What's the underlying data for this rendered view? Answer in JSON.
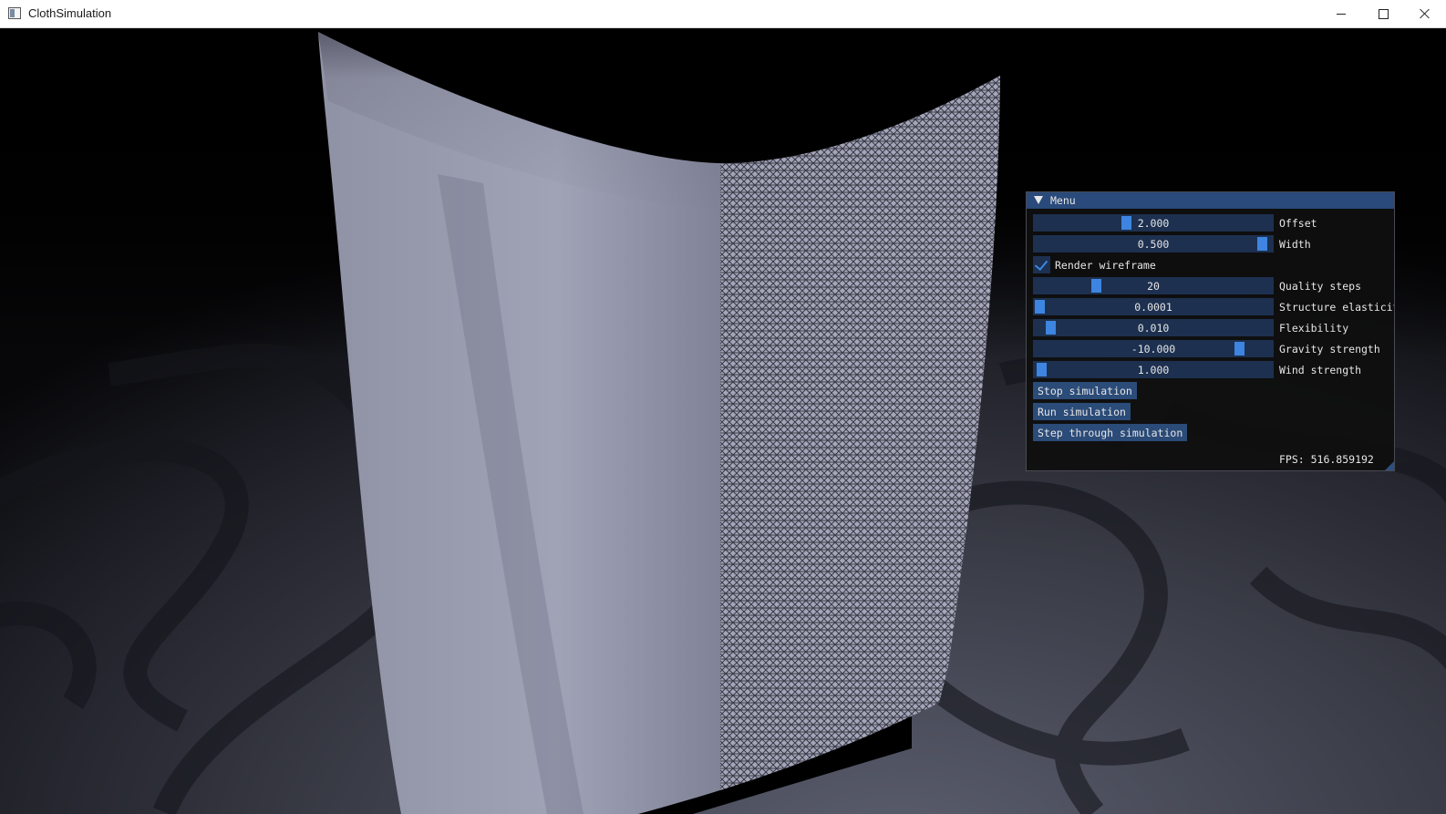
{
  "window": {
    "title": "ClothSimulation"
  },
  "menu": {
    "title": "Menu",
    "sliders": [
      {
        "id": "offset",
        "label": "Offset",
        "value": "2.000",
        "fraction": 0.38
      },
      {
        "id": "width",
        "label": "Width",
        "value": "0.500",
        "fraction": 0.98
      },
      {
        "id": "quality",
        "label": "Quality steps",
        "value": "20",
        "fraction": 0.25
      },
      {
        "id": "elasticity",
        "label": "Structure elasticit",
        "value": "0.0001",
        "fraction": 0.0
      },
      {
        "id": "flexibility",
        "label": "Flexibility",
        "value": "0.010",
        "fraction": 0.05
      },
      {
        "id": "gravity",
        "label": "Gravity strength",
        "value": "-10.000",
        "fraction": 0.88
      },
      {
        "id": "wind",
        "label": "Wind strength",
        "value": "1.000",
        "fraction": 0.01
      }
    ],
    "checkbox": {
      "label": "Render wireframe",
      "checked": true
    },
    "buttons": {
      "stop": "Stop simulation",
      "run": "Run simulation",
      "step": "Step through simulation"
    },
    "fps": "FPS: 516.859192"
  },
  "colors": {
    "panel_title": "#294a7a",
    "slider_bg": "#1d3050",
    "slider_grab": "#3d85e0",
    "button_bg": "#2b4b78",
    "cloth": "#9a9cae"
  },
  "icons": {
    "app": "app-icon",
    "minimize": "minimize-icon",
    "maximize": "maximize-icon",
    "close": "close-icon",
    "collapse": "collapse-arrow-icon",
    "check": "checkmark-icon"
  }
}
